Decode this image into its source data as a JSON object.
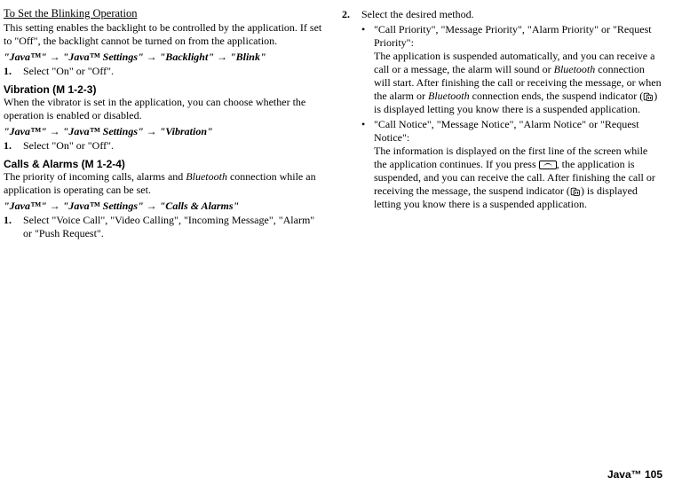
{
  "left": {
    "set_blink_heading": "To Set the Blinking Operation",
    "set_blink_body_1": "This setting enables the backlight to be controlled by the application. If set to \"Off\", the backlight cannot be turned on from the application.",
    "blink_path": "\"Java™\" → \"Java™ Settings\" → \"Backlight\" → \"Blink\"",
    "step_select_onoff": "Select \"On\" or \"Off\".",
    "vibration_heading": "Vibration (M 1-2-3)",
    "vibration_body": "When the vibrator is set in the application, you can choose whether the operation is enabled or disabled.",
    "vibration_path": "\"Java™\" → \"Java™ Settings\" → \"Vibration\"",
    "calls_heading": "Calls & Alarms (M 1-2-4)",
    "calls_body_pre": "The priority of incoming calls, alarms and ",
    "calls_body_post": " connection while an application is operating can be set.",
    "calls_path": "\"Java™\" → \"Java™ Settings\" → \"Calls & Alarms\"",
    "calls_step1": "Select \"Voice Call\", \"Video Calling\", \"Incoming Message\", \"Alarm\" or \"Push Request\"."
  },
  "right": {
    "step2": "Select the desired method.",
    "b1_quotes": "\"Call Priority\", \"Message Priority\", \"Alarm Priority\" or \"Request Priority\":",
    "b1_l1": "The application is suspended automatically, and you can receive a call or a message, the alarm will sound or ",
    "b1_l1b": " connection will start. After finishing the call or receiving the message, or when the alarm or ",
    "b1_l1c": " connection ends, the suspend indicator (",
    "b1_l1d": ") is displayed letting you know there is a suspended application.",
    "b2_quotes": "\"Call Notice\", \"Message Notice\", \"Alarm Notice\" or \"Request Notice\":",
    "b2_l1": "The information is displayed on the first line of the screen while the application continues. If you press ",
    "b2_l2": ", the application is suspended, and you can receive the call. After finishing the call or receiving the message, the suspend indicator (",
    "b2_l3": ") is displayed letting you know there is a suspended application."
  },
  "words": {
    "bluetooth": "Bluetooth"
  },
  "footer": "Java™   105"
}
